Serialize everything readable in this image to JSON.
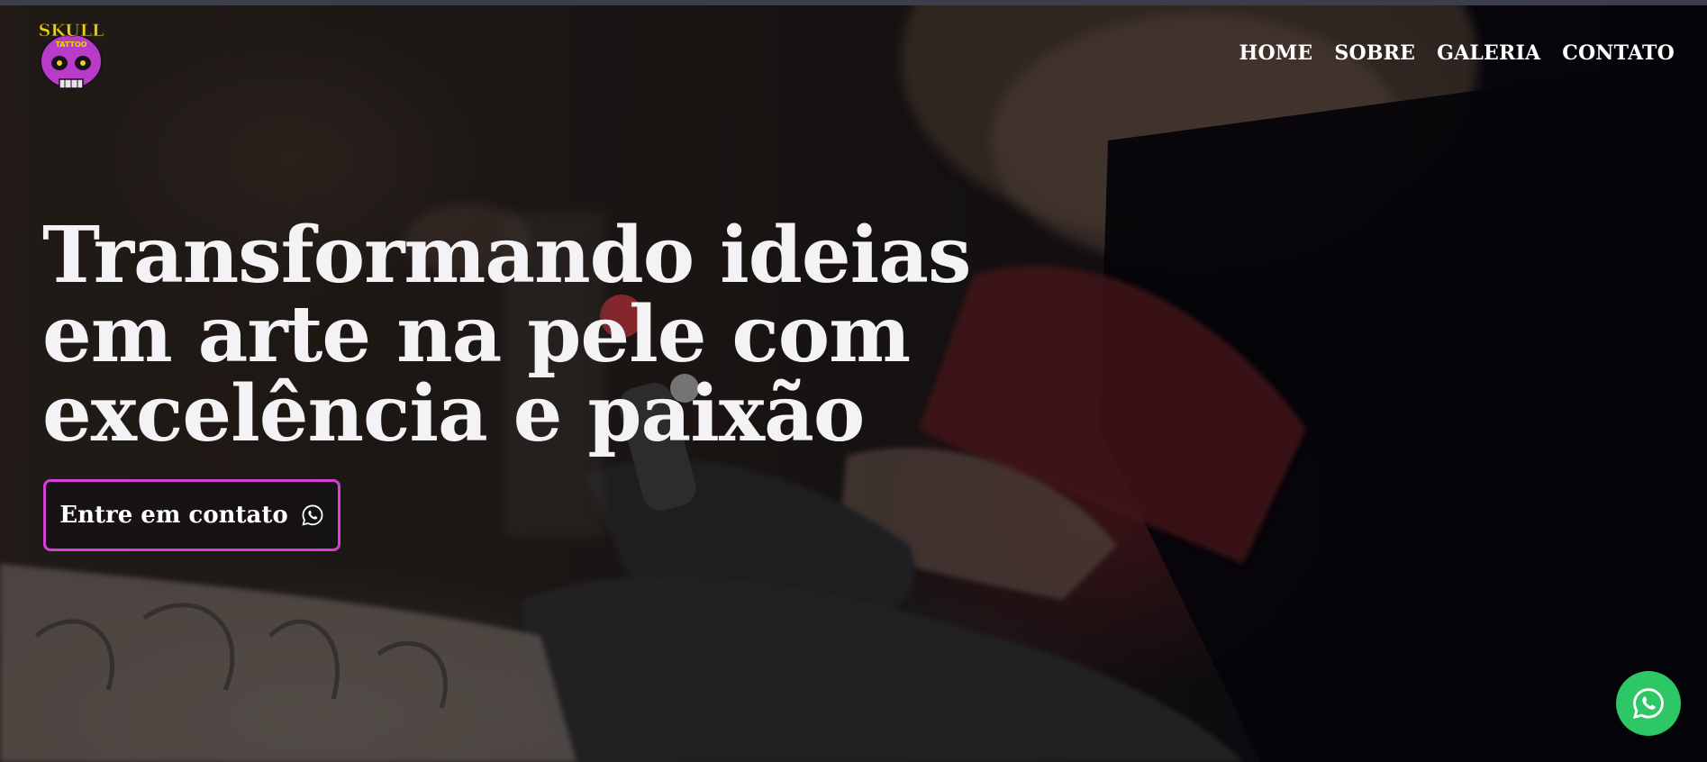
{
  "nav": {
    "items": [
      "HOME",
      "SOBRE",
      "GALERIA",
      "CONTATO"
    ]
  },
  "logo": {
    "text_top": "SKULL",
    "text_bottom": "TATTOO"
  },
  "hero": {
    "headline_lines": [
      "Transformando ideias",
      "em arte na pele com",
      "excelência e paixão"
    ],
    "cta_label": "Entre em contato"
  },
  "icons": {
    "cta_icon": "whatsapp-icon",
    "floating_button_icon": "whatsapp-icon"
  },
  "colors": {
    "accent": "#d63fd6",
    "whatsapp_green": "#2dc766",
    "logo_purple": "#b83cc8",
    "logo_yellow": "#e8d21a"
  }
}
